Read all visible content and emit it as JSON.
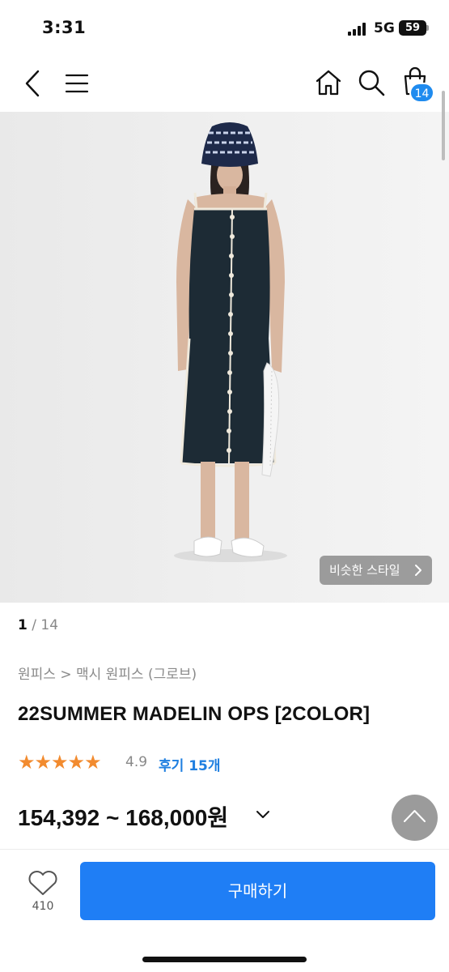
{
  "status_bar": {
    "time": "3:31",
    "network": "5G",
    "battery": "59"
  },
  "nav": {
    "cart_count": "14"
  },
  "hero": {
    "similar_style_label": "비슷한 스타일"
  },
  "pager": {
    "current": "1",
    "total": "14"
  },
  "breadcrumb": "원피스 > 맥시 원피스 (그로브)",
  "product": {
    "title": "22SUMMER MADELIN OPS [2COLOR]",
    "stars": "★★★★★",
    "rating": "4.9",
    "reviews": "후기 15개",
    "price": "154,392 ~ 168,000원"
  },
  "bottom": {
    "like_count": "410",
    "buy_label": "구매하기"
  },
  "colors": {
    "accent": "#1f7ef5",
    "star": "#f28b2f",
    "badge": "#1f8bef"
  }
}
